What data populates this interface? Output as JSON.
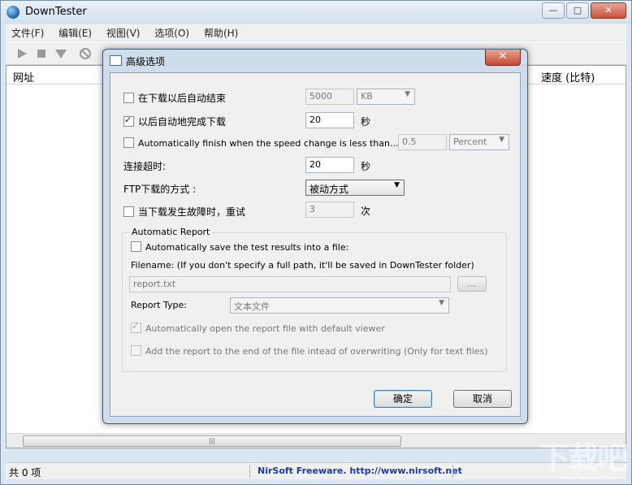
{
  "app": {
    "title": "DownTester"
  },
  "menu": [
    "文件(F)",
    "编辑(E)",
    "视图(V)",
    "选项(O)",
    "帮助(H)"
  ],
  "list": {
    "col_url": "网址",
    "col_speed": "速度 (比特)"
  },
  "status": {
    "count": "共 0 项",
    "link": "NirSoft Freeware.  http://www.nirsoft.net"
  },
  "dialog": {
    "title": "高级选项",
    "auto_end_label": "在下载以后自动结束",
    "auto_end_value": "5000",
    "auto_end_unit": "KB",
    "auto_complete_label": "以后自动地完成下载",
    "auto_complete_value": "20",
    "auto_complete_unit": "秒",
    "speed_change_label": "Automatically finish when the speed change is less than...",
    "speed_change_value": "0.5",
    "speed_change_unit": "Percent",
    "timeout_label": "连接超时:",
    "timeout_value": "20",
    "timeout_unit": "秒",
    "ftp_label": "FTP下载的方式 :",
    "ftp_value": "被动方式",
    "retry_label": "当下载发生故障时，重试",
    "retry_value": "3",
    "retry_unit": "次",
    "group_label": "Automatic Report",
    "save_results_label": "Automatically save the test results into a file:",
    "filename_label": "Filename: (If you don't specify a full path, it'll be saved in DownTester folder)",
    "filename_value": "report.txt",
    "browse_label": "...",
    "report_type_label": "Report Type:",
    "report_type_value": "文本文件",
    "open_report_label": "Automatically open the report file with default viewer",
    "append_label": "Add the report to the end of the file intead of overwriting (Only for text files)",
    "ok_label": "确定",
    "cancel_label": "取消"
  },
  "checks": {
    "auto_end": false,
    "auto_complete": true,
    "speed_change": false,
    "retry": false,
    "save_results": false,
    "open_report": true,
    "append": false
  },
  "watermark": {
    "text": "下载吧",
    "sub": "www.xiazaiba.com"
  }
}
